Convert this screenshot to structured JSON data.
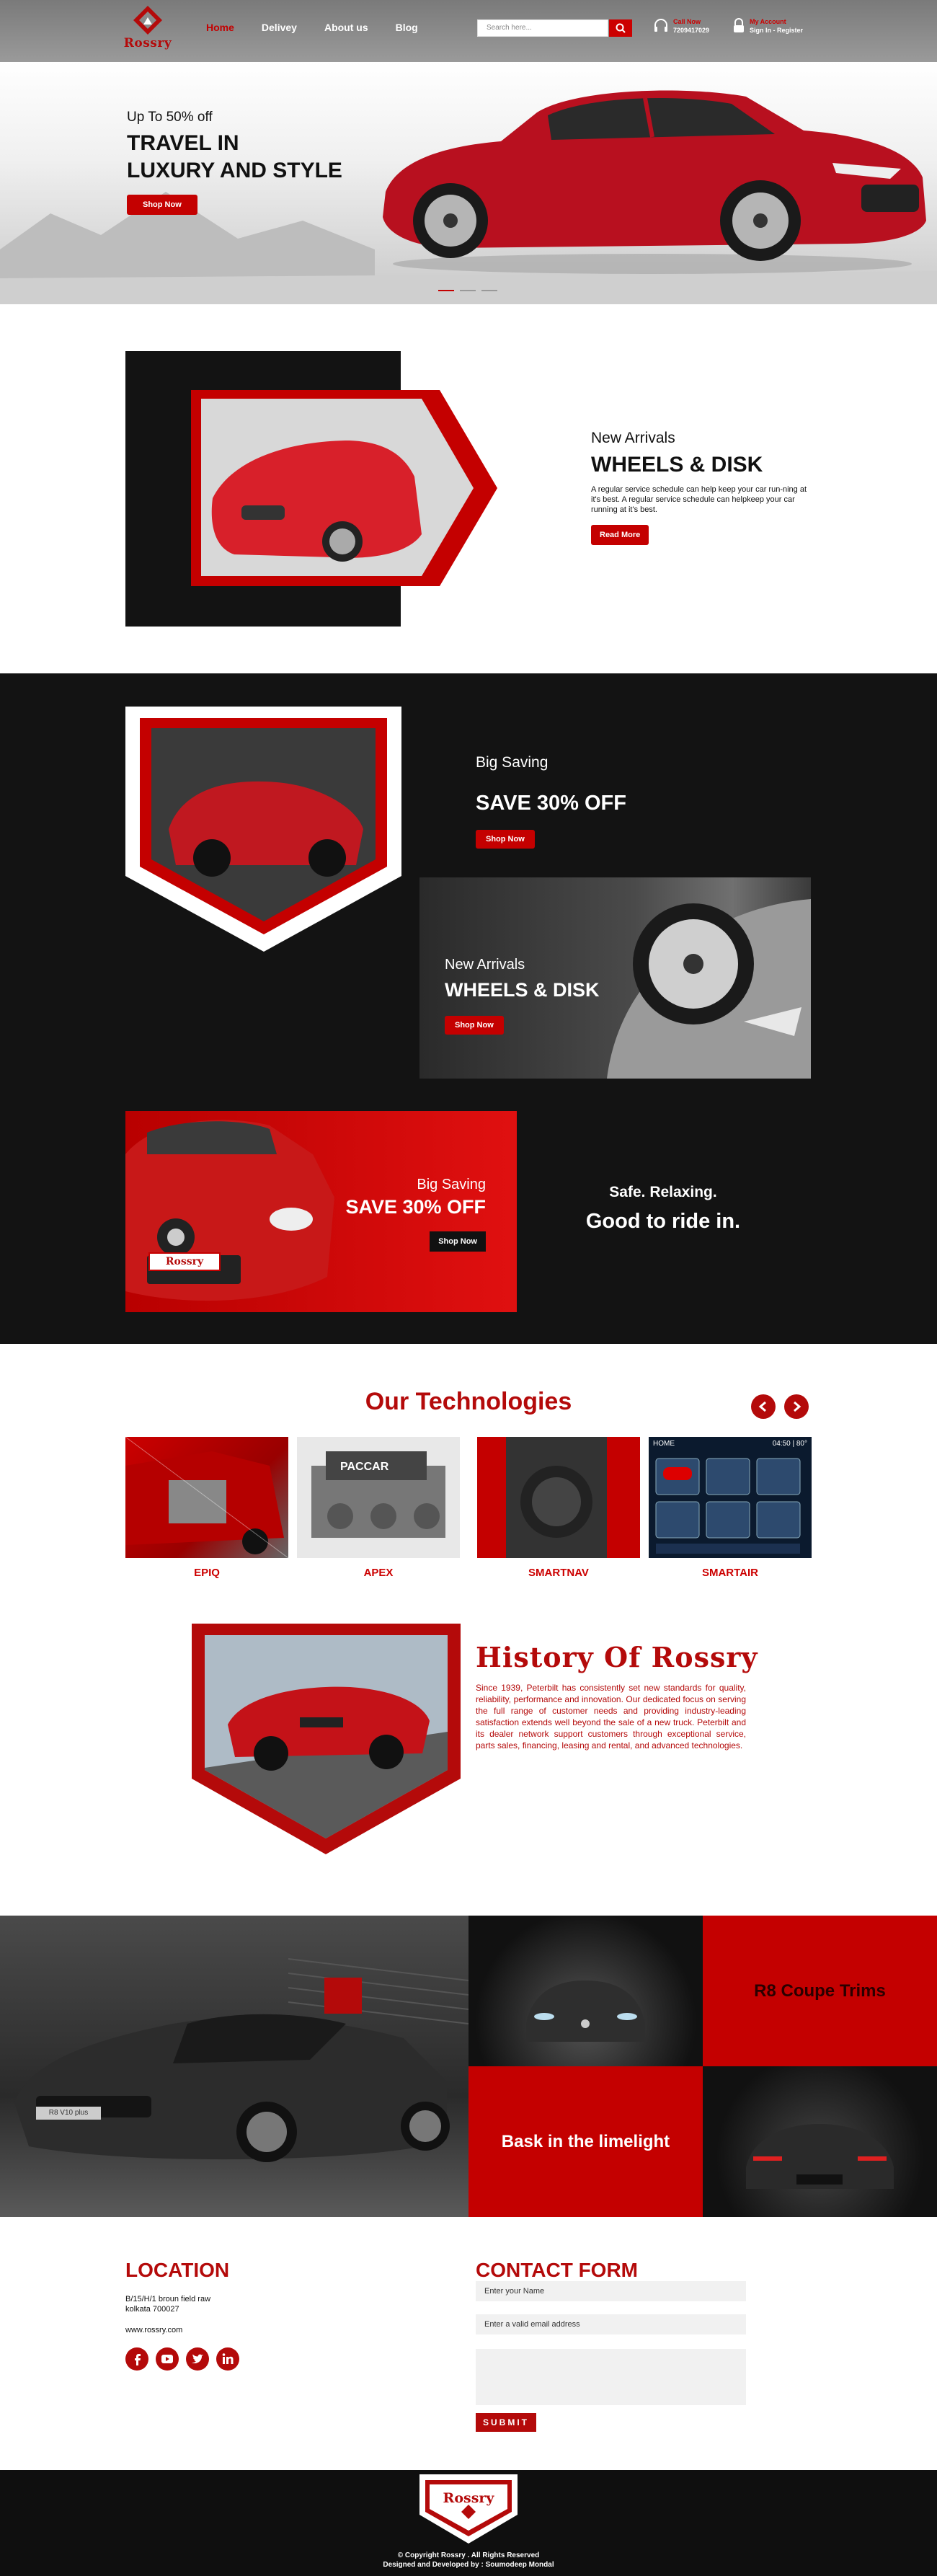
{
  "brand": {
    "name": "Rossry"
  },
  "nav": {
    "items": [
      "Home",
      "Delivey",
      "About us",
      "Blog"
    ]
  },
  "search": {
    "placeholder": "Search here..."
  },
  "call": {
    "label": "Call Now",
    "number": "7209417029"
  },
  "account": {
    "label": "My Account",
    "links": "Sign In  -  Register"
  },
  "hero": {
    "sub": "Up To 50% off",
    "title1": "TRAVEL IN",
    "title2": "LUXURY AND STYLE",
    "cta": "Shop Now",
    "slides": 3
  },
  "arrivals": {
    "label": "New Arrivals",
    "title": "WHEELS & DISK",
    "desc": "A regular service schedule can help keep your car run-ning at it's best. A regular service schedule can helpkeep your car running at it's best.",
    "cta": "Read More"
  },
  "promo1": {
    "label": "Big Saving",
    "title": "SAVE 30% OFF",
    "cta": "Shop Now"
  },
  "promo2": {
    "label": "New Arrivals",
    "title": "WHEELS & DISK",
    "cta": "Shop Now"
  },
  "promo3": {
    "label": "Big Saving",
    "title": "SAVE 30% OFF",
    "cta": "Shop Now",
    "plate": "Rossry"
  },
  "tagline": {
    "line1": "Safe. Relaxing.",
    "line2": "Good to ride in."
  },
  "tech": {
    "title": "Our Technologies",
    "items": [
      "EPIQ",
      "APEX",
      "SMARTNAV",
      "SMARTAIR"
    ],
    "screen_time": "04:50 | 80°",
    "screen_home": "HOME"
  },
  "history": {
    "title": "History Of Rossry",
    "text": "Since 1939, Peterbilt has consistently set new standards for quality, reliability, performance and innovation. Our dedicated focus on serving the full range of customer needs and providing industry-leading satisfaction extends well beyond the sale of a new truck. Peterbilt and its dealer network support customers through exceptional service, parts sales, financing, leasing and rental, and advanced technologies."
  },
  "gallery": {
    "tile1": "R8 Coupe Trims",
    "tile2": "Bask in the limelight",
    "plate": "R8 V10 plus"
  },
  "location": {
    "title": "LOCATION",
    "address1": "B/15/H/1 broun field raw",
    "address2": "kolkata 700027",
    "website": "www.rossry.com",
    "social": [
      "facebook-icon",
      "youtube-icon",
      "twitter-icon",
      "linkedin-icon"
    ]
  },
  "contact": {
    "title": "CONTACT FORM",
    "name_ph": "Enter your Name",
    "email_ph": "Enter a valid email address",
    "submit": "SUBMIT"
  },
  "footer": {
    "copy": "© Copyright Rossry .  All Rights Reserved",
    "credit": "Designed and Developed by : Soumodeep Mondal"
  },
  "colors": {
    "accent": "#c40000",
    "dark": "#131313"
  }
}
